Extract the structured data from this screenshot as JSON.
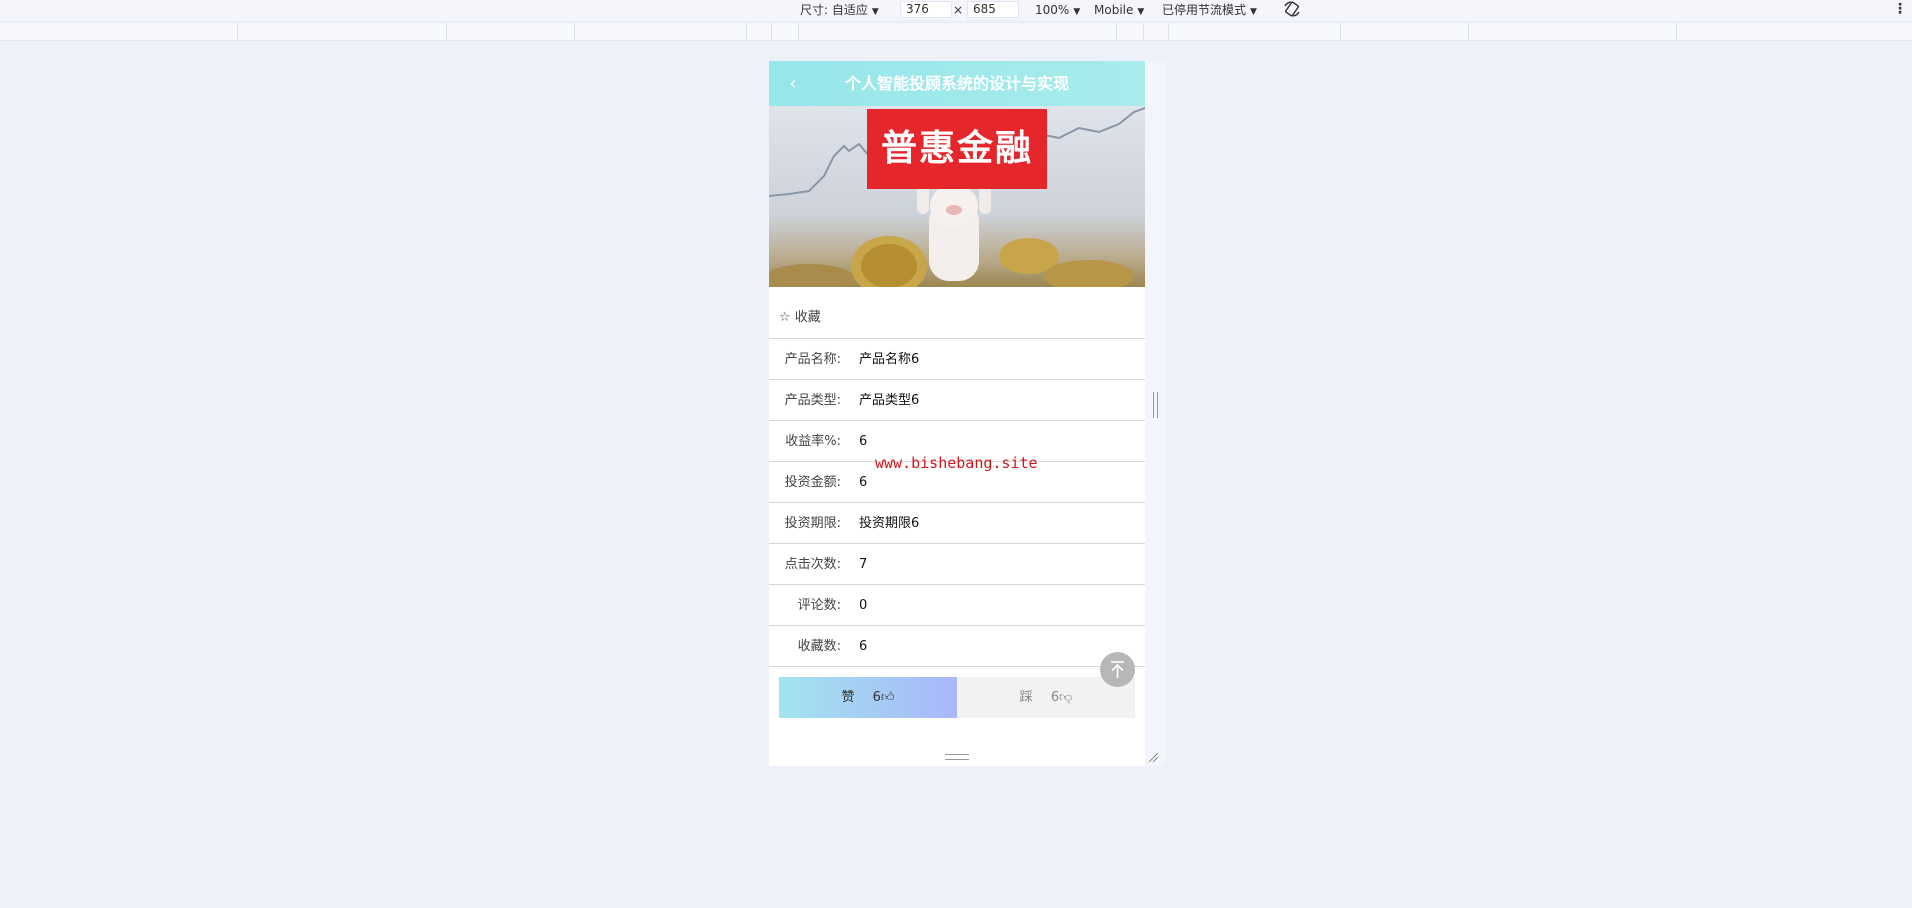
{
  "devtools": {
    "size_label": "尺寸: 自适应",
    "width": "376",
    "times": "×",
    "height": "685",
    "zoom": "100%",
    "device": "Mobile",
    "throttle": "已停用节流模式"
  },
  "app": {
    "title": "个人智能投顾系统的设计与实现",
    "banner_text": "普惠金融",
    "favorite_label": "☆ 收藏"
  },
  "details": [
    {
      "label": "产品名称:",
      "value": "产品名称6"
    },
    {
      "label": "产品类型:",
      "value": "产品类型6"
    },
    {
      "label": "收益率%:",
      "value": "6"
    },
    {
      "label": "投资金额:",
      "value": "6"
    },
    {
      "label": "投资期限:",
      "value": "投资期限6"
    },
    {
      "label": "点击次数:",
      "value": "7"
    },
    {
      "label": "评论数:",
      "value": "0"
    },
    {
      "label": "收藏数:",
      "value": "6"
    }
  ],
  "votes": {
    "like_label": "赞",
    "like_count": "6",
    "dislike_label": "踩",
    "dislike_count": "6"
  },
  "watermark": "www.bishebang.site",
  "colors": {
    "header": "#96e6ea",
    "like_gradient_start": "#a2e4ef",
    "like_gradient_end": "#a9b7f9",
    "banner_red": "#e5262a",
    "watermark": "#d0181c"
  },
  "icons": [
    "back-arrow-icon",
    "star-icon",
    "thumbs-up-icon",
    "thumbs-down-icon",
    "arrow-up-icon",
    "rotate-icon",
    "more-vert-icon"
  ]
}
